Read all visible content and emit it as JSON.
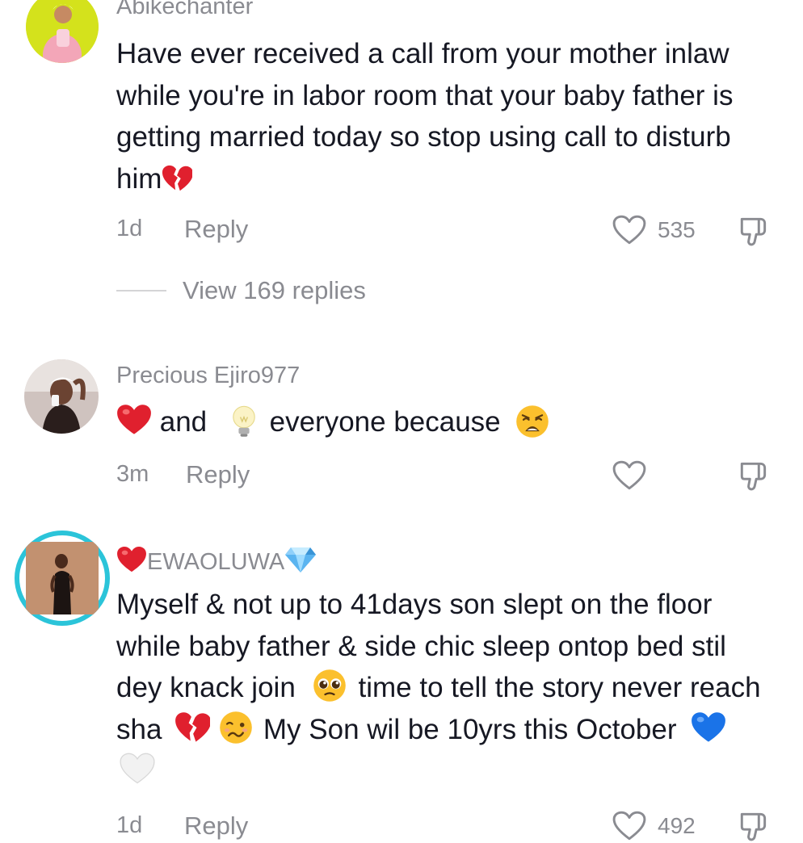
{
  "comments": [
    {
      "username": "Abikechanter",
      "text_parts": [
        "Have ever received a call from your mother inlaw while you're in labor room that your baby father is getting married today so stop using call to disturb him"
      ],
      "emojis": [
        "broken-heart"
      ],
      "time": "1d",
      "reply_label": "Reply",
      "likes": "535",
      "replies_label": "View 169 replies"
    },
    {
      "username": "Precious Ejiro977",
      "text_parts": [
        "and",
        "everyone because"
      ],
      "emojis": [
        "red-heart",
        "light-bulb",
        "weary-face"
      ],
      "time": "3m",
      "reply_label": "Reply",
      "likes": ""
    },
    {
      "username": "EWAOLUWA",
      "username_emojis": [
        "red-heart",
        "gem"
      ],
      "text_parts": [
        "Myself & not up to 41days son slept on the floor while baby father & side chic sleep ontop bed stil dey knack join",
        "time to tell the story never reach sha",
        "My Son wil be 10yrs this October"
      ],
      "emojis": [
        "pleading-face",
        "broken-heart",
        "woozy-face",
        "blue-heart",
        "white-heart"
      ],
      "time": "1d",
      "reply_label": "Reply",
      "likes": "492"
    }
  ],
  "colors": {
    "text": "#161823",
    "secondary": "#8a8b91",
    "story_ring": "#2bc4d9",
    "avatar1_bg": "#d4e21c"
  }
}
